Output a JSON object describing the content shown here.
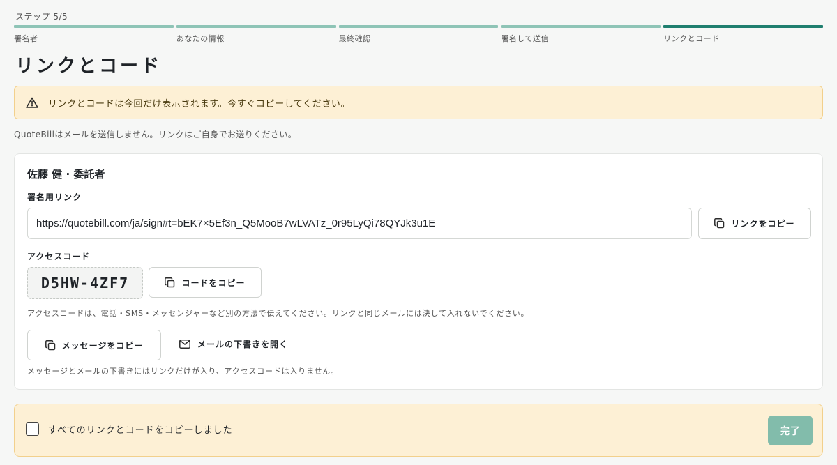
{
  "step_counter": "ステップ 5/5",
  "steps": [
    {
      "label": "署名者"
    },
    {
      "label": "あなたの情報"
    },
    {
      "label": "最終確認"
    },
    {
      "label": "署名して送信"
    },
    {
      "label": "リンクとコード"
    }
  ],
  "page_title": "リンクとコード",
  "warning": "リンクとコードは今回だけ表示されます。今すぐコピーしてください。",
  "info_text": "QuoteBillはメールを送信しません。リンクはご自身でお送りください。",
  "signer": {
    "heading": "佐藤 健 · 委託者",
    "link_label": "署名用リンク",
    "link_value": "https://quotebill.com/ja/sign#t=bEK7×5Ef3n_Q5MooB7wLVATz_0r95LyQi78QYJk3u1E",
    "copy_link_label": "リンクをコピー",
    "code_label": "アクセスコード",
    "code_value": "D5HW-4ZF7",
    "copy_code_label": "コードをコピー",
    "code_hint": "アクセスコードは、電話・SMS・メッセンジャーなど別の方法で伝えてください。リンクと同じメールには決して入れないでください。",
    "copy_message_label": "メッセージをコピー",
    "open_mail_label": "メールの下書きを開く",
    "message_hint": "メッセージとメールの下書きにはリンクだけが入り、アクセスコードは入りません。"
  },
  "confirm": {
    "checkbox_label": "すべてのリンクとコードをコピーしました",
    "checked": false,
    "done_label": "完了"
  },
  "colors": {
    "step_done": "#8ec4b6",
    "step_current": "#1f7f6f",
    "warning_bg": "#fdf0d5",
    "warning_border": "#f2d08c",
    "done_button": "#82bcab"
  },
  "icons": {
    "warning": "warning-triangle-icon",
    "copy": "copy-icon",
    "mail": "mail-icon"
  }
}
